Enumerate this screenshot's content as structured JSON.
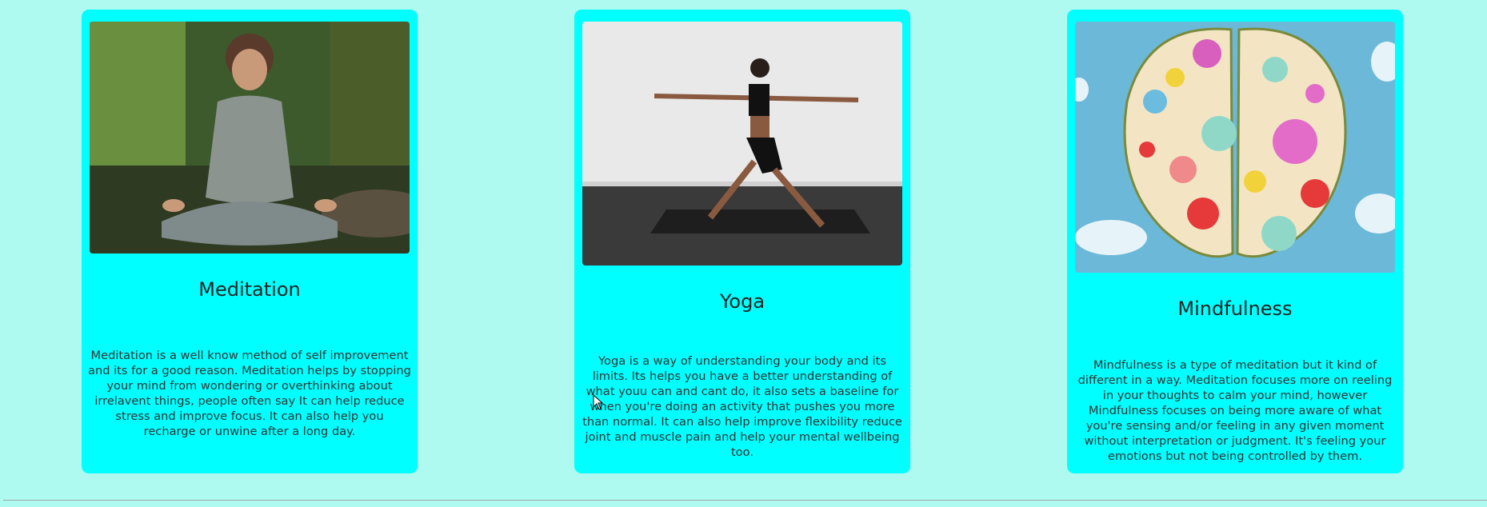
{
  "cards": [
    {
      "title": "Meditation",
      "image_icon": "meditation-photo",
      "description": "Meditation is a well know method of self improvement and its for a good reason. Meditation helps by stopping your mind from wondering or overthinking about irrelavent things, people often say It can help reduce stress and improve focus. It can also help you recharge or unwine after a long day."
    },
    {
      "title": "Yoga",
      "image_icon": "yoga-photo",
      "description": "Yoga is a way of understanding your body and its limits. Its helps you have a better understanding of what youu can and cant do, it also sets a baseline for when you're doing an activity that pushes you more than normal. It can also help improve flexibility reduce joint and muscle pain and help your mental wellbeing too."
    },
    {
      "title": "Mindfulness",
      "image_icon": "flower-brain-illustration",
      "description": "Mindfulness is a type of meditation but it kind of different in a way. Meditation focuses more on reeling in your thoughts to calm your mind, however Mindfulness focuses on being more aware of what you're sensing and/or feeling in any given moment without interpretation or judgment. It's feeling your emotions but not being controlled by them."
    }
  ],
  "colors": {
    "page_background": "#affaf0",
    "card_background": "#00ffff"
  }
}
